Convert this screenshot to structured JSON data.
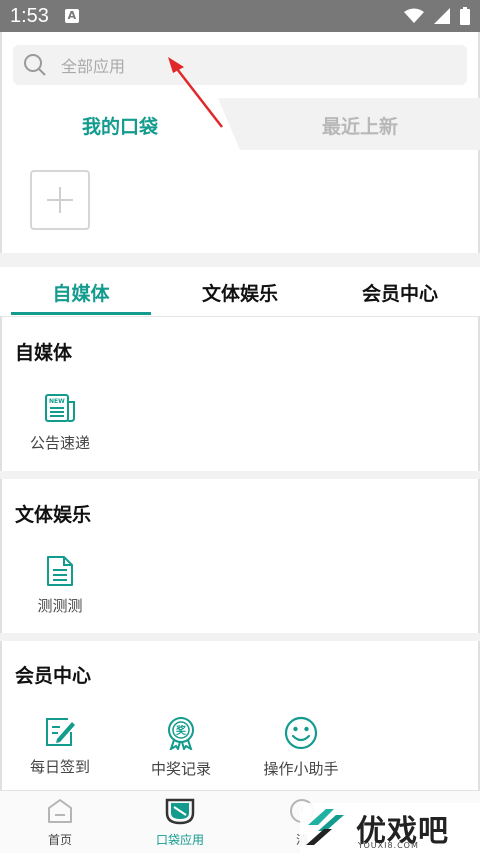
{
  "status_bar": {
    "time": "1:53",
    "notification_badge": "A"
  },
  "search": {
    "placeholder": "全部应用"
  },
  "pocket_tabs": {
    "mine": "我的口袋",
    "latest": "最近上新"
  },
  "category_tabs": [
    "自媒体",
    "文体娱乐",
    "会员中心"
  ],
  "sections": [
    {
      "title": "自媒体",
      "apps": [
        {
          "label": "公告速递",
          "icon": "newspaper-icon"
        }
      ]
    },
    {
      "title": "文体娱乐",
      "apps": [
        {
          "label": "测测测",
          "icon": "document-icon"
        }
      ]
    },
    {
      "title": "会员中心",
      "apps": [
        {
          "label": "每日签到",
          "icon": "sign-in-icon"
        },
        {
          "label": "中奖记录",
          "icon": "award-ribbon-icon",
          "badge_text": "奖"
        },
        {
          "label": "操作小助手",
          "icon": "smiley-icon"
        }
      ]
    }
  ],
  "bottom_nav": [
    {
      "label": "首页",
      "icon": "home-icon"
    },
    {
      "label": "口袋应用",
      "icon": "pocket-icon"
    },
    {
      "label": "消",
      "icon": "message-icon"
    }
  ],
  "watermark": {
    "text": "优戏吧",
    "sub": "YOUXI8.COM"
  },
  "colors": {
    "accent": "#139b8e",
    "status_bar": "#787878",
    "band": "#f2f2f2"
  }
}
